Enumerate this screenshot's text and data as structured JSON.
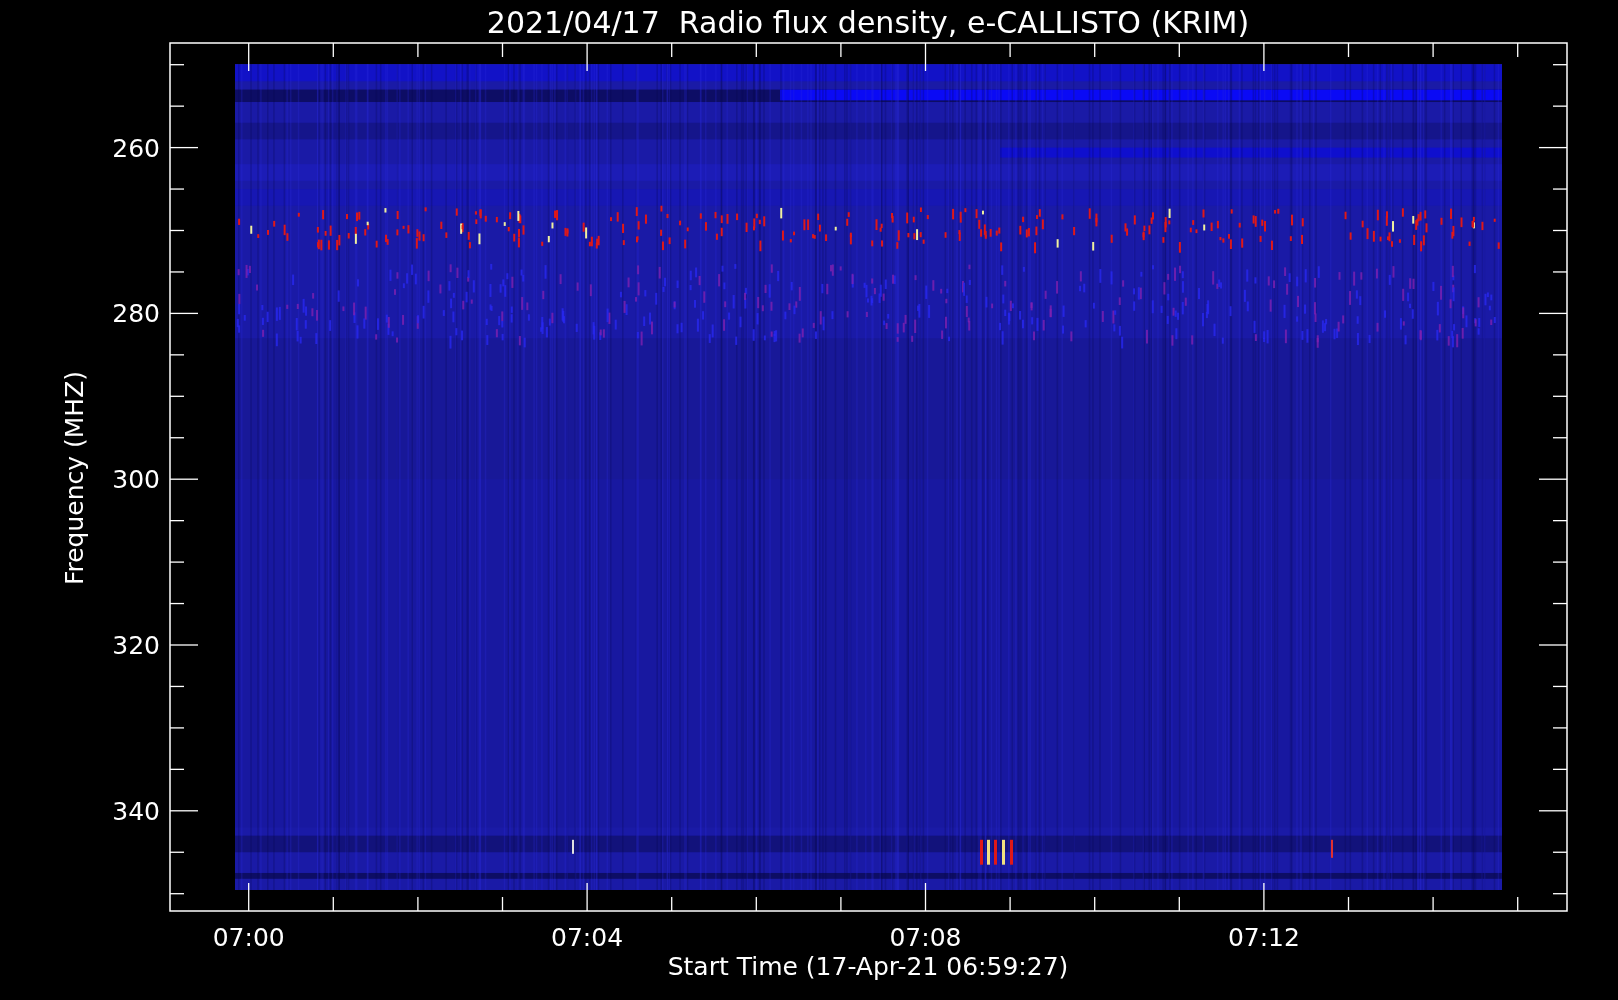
{
  "title": "2021/04/17  Radio flux density, e-CALLISTO (KRIM)",
  "plot": {
    "y_label": "Frequency (MHZ)",
    "x_label": "Start Time (17-Apr-21 06:59:27)",
    "y_ticks": [
      "260",
      "280",
      "300",
      "320",
      "340"
    ],
    "x_ticks": [
      "07:00",
      "07:04",
      "07:08",
      "07:12"
    ]
  }
}
